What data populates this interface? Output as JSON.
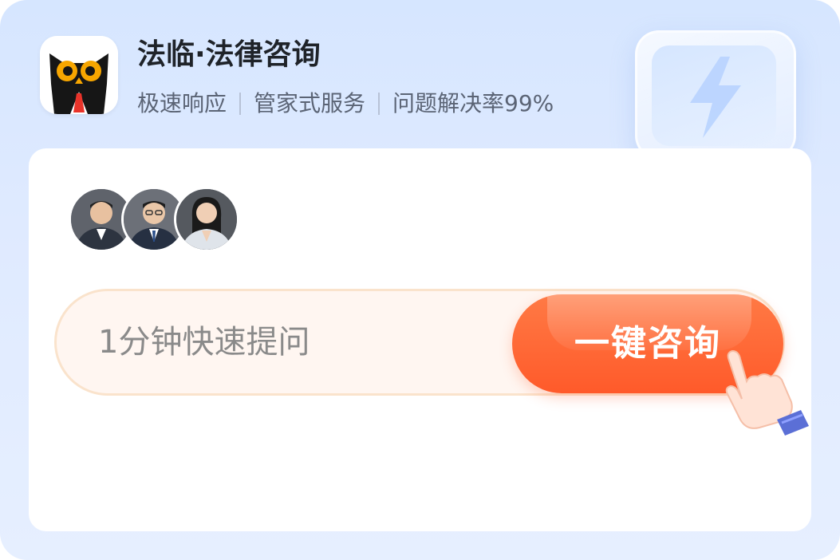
{
  "app": {
    "title": "法临·法律咨询",
    "logo_icon": "owl-lawyer-logo"
  },
  "taglines": [
    "极速响应",
    "管家式服务",
    "问题解决率99%"
  ],
  "avatars": [
    {
      "name": "lawyer-avatar-1",
      "icon": "man-in-suit"
    },
    {
      "name": "lawyer-avatar-2",
      "icon": "man-in-suit-glasses"
    },
    {
      "name": "lawyer-avatar-3",
      "icon": "woman-in-blazer"
    }
  ],
  "question": {
    "placeholder": "1分钟快速提问"
  },
  "cta": {
    "label": "一键咨询"
  },
  "decor": {
    "icon": "lightning-bolt-icon",
    "pointer": "pointing-hand-icon"
  },
  "colors": {
    "background": "#dbe8ff",
    "accent": "#ff5a2a",
    "pill_bg": "#fff6f1",
    "pill_border": "#fae3cc"
  }
}
